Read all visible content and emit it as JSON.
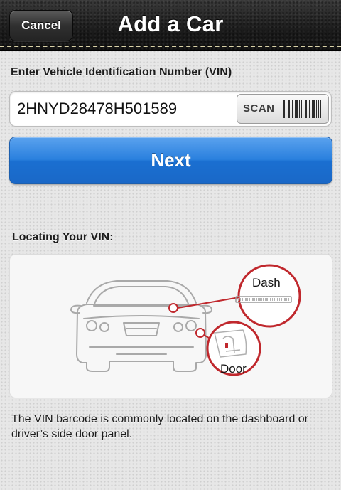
{
  "nav": {
    "cancel_label": "Cancel",
    "title": "Add a Car"
  },
  "vin": {
    "label": "Enter Vehicle Identification Number (VIN)",
    "value": "2HNYD28478H501589",
    "scan_label": "SCAN"
  },
  "next": {
    "label": "Next"
  },
  "locating": {
    "heading": "Locating Your VIN:",
    "dash_label": "Dash",
    "door_label": "Door"
  },
  "info": {
    "text": "The VIN barcode is commonly located on the dashboard or driver’s side door panel."
  },
  "colors": {
    "accent_blue": "#1a6fd1",
    "callout_red": "#c0282d",
    "header_dark": "#1b1b1b"
  },
  "icons": {
    "barcode": "barcode-icon",
    "car": "car-illustration"
  }
}
